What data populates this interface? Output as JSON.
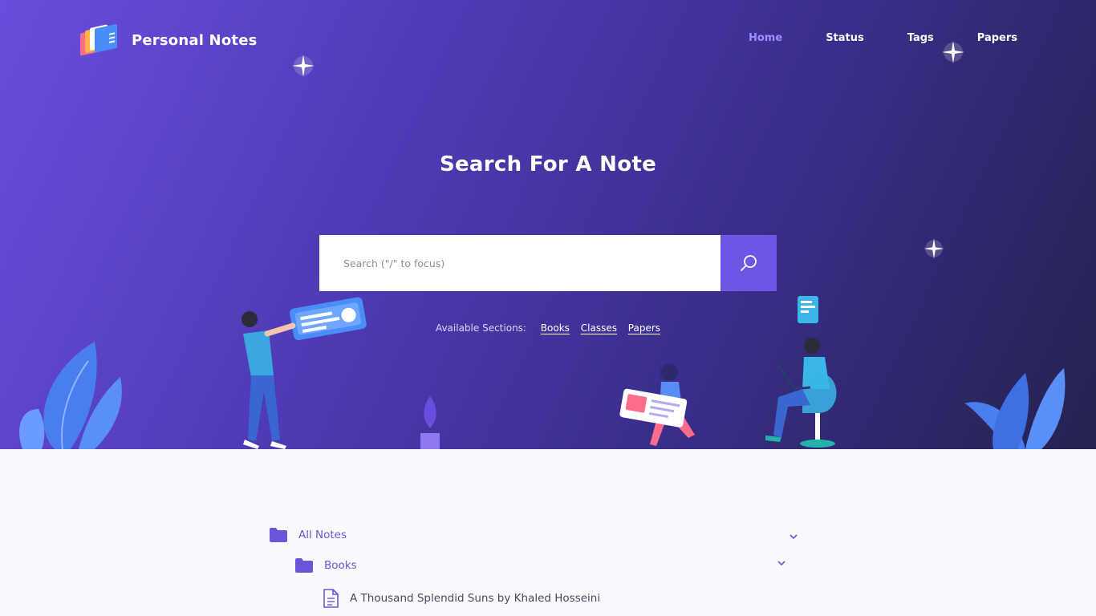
{
  "app": {
    "title": "Personal Notes",
    "logo_icon": "stacked-books-icon"
  },
  "nav": {
    "items": [
      {
        "label": "Home",
        "active": true
      },
      {
        "label": "Status",
        "active": false
      },
      {
        "label": "Tags",
        "active": false
      },
      {
        "label": "Papers",
        "active": false
      }
    ]
  },
  "hero": {
    "title": "Search For A Note",
    "search": {
      "placeholder": "Search (\"/\" to focus)",
      "value": "",
      "button_icon": "search-icon"
    },
    "sections_label": "Available Sections:",
    "sections": [
      "Books",
      "Classes",
      "Papers"
    ]
  },
  "tree": {
    "root": {
      "label": "All Notes",
      "icon": "folder-icon",
      "expanded": true
    },
    "child": {
      "label": "Books",
      "icon": "folder-icon",
      "expanded": true
    },
    "items": [
      {
        "label": "A Thousand Splendid Suns by Khaled Hosseini",
        "icon": "document-icon"
      }
    ]
  },
  "colors": {
    "accent": "#6f55e6",
    "hero_start": "#6a4ddc",
    "hero_end": "#25224f",
    "active_nav": "#9f8cff",
    "folder": "#6a55d8"
  }
}
